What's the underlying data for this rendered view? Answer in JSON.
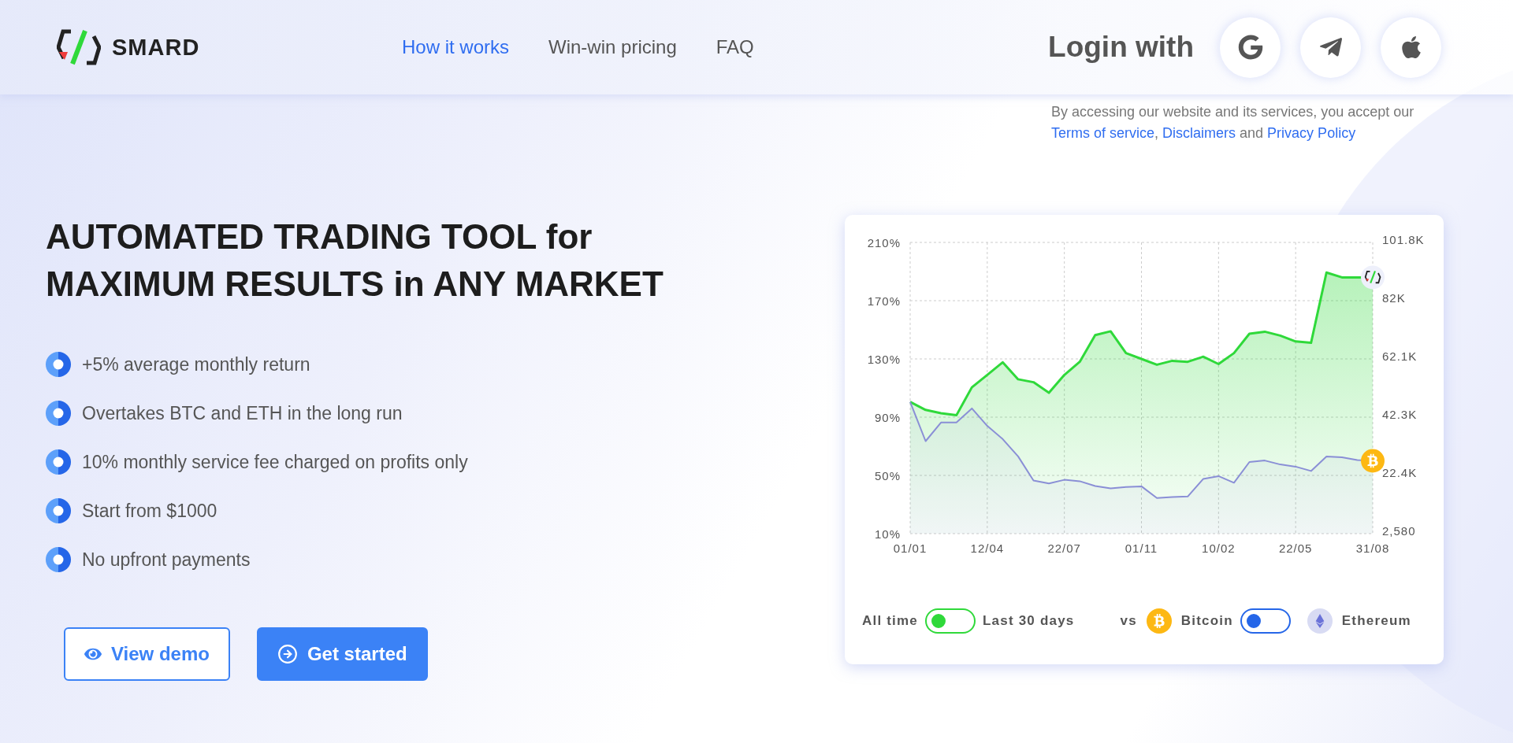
{
  "header": {
    "brand": "SMARD",
    "nav": [
      {
        "label": "How it works",
        "selected": true
      },
      {
        "label": "Win-win pricing",
        "selected": false
      },
      {
        "label": "FAQ",
        "selected": false
      }
    ],
    "login_label": "Login with",
    "login_options": [
      {
        "kind": "google"
      },
      {
        "kind": "telegram"
      },
      {
        "kind": "apple"
      }
    ]
  },
  "terms": [
    {
      "kind": "text",
      "text": "By accessing our website and its services, you accept our "
    },
    {
      "kind": "link",
      "text": "Terms of service"
    },
    {
      "kind": "text",
      "text": ", "
    },
    {
      "kind": "link",
      "text": "Disclaimers"
    },
    {
      "kind": "text",
      "text": " and "
    },
    {
      "kind": "link",
      "text": "Privacy Policy"
    }
  ],
  "hero": {
    "headline": [
      "AUTOMATED TRADING TOOL for",
      "MAXIMUM RESULTS in ANY MARKET"
    ],
    "features": [
      "+5% average monthly return",
      "Overtakes BTC and ETH in the long run",
      "10% monthly service fee charged on profits only",
      "Start from $1000",
      "No upfront payments"
    ],
    "buttons": [
      {
        "kind": "outline",
        "label": "View demo"
      },
      {
        "kind": "primary",
        "label": "Get started"
      }
    ]
  },
  "chart": {
    "chart_data": {
      "type": "area",
      "categories": [
        "01/01",
        null,
        null,
        null,
        null,
        "12/04",
        null,
        null,
        null,
        null,
        "22/07",
        null,
        null,
        null,
        null,
        "01/11",
        null,
        null,
        null,
        null,
        "10/02",
        null,
        null,
        null,
        null,
        "22/05",
        null,
        null,
        null,
        null,
        "31/08"
      ],
      "series": [
        {
          "color": "#2fd93a",
          "values": [
            100.5,
            95,
            92.7,
            91.3,
            110.5,
            119,
            127.7,
            116,
            114,
            106.7,
            119,
            128,
            146.3,
            149,
            134,
            130,
            126,
            128.7,
            128,
            131.5,
            126.5,
            134,
            147.3,
            148.7,
            146,
            142,
            141,
            189.3,
            186,
            186,
            186
          ]
        },
        {
          "color": "#8a8fd6",
          "values": [
            100.5,
            73.5,
            86.3,
            86.3,
            96,
            84,
            75,
            63,
            46.5,
            44.5,
            47,
            46,
            42.7,
            41,
            42,
            42.5,
            34.5,
            35.2,
            35.5,
            47.5,
            49.5,
            45,
            59.2,
            60.2,
            57.5,
            56,
            53,
            63,
            62.4,
            60.5,
            60
          ]
        }
      ],
      "ylim": [
        10,
        210
      ],
      "grid": true,
      "yticks": [
        {
          "value": 210,
          "label": "210%"
        },
        {
          "value": 170,
          "label": "170%"
        },
        {
          "value": 130,
          "label": "130%"
        },
        {
          "value": 90,
          "label": "90%"
        },
        {
          "value": 50,
          "label": "50%"
        },
        {
          "value": 10,
          "label": "10%"
        }
      ]
    },
    "right_axis_labels": [
      "101.8K",
      "82K",
      "62.1K",
      "42.3K",
      "22.4K",
      "2,580"
    ],
    "controls": {
      "period": {
        "left_label": "All time",
        "right_label": "Last 30 days",
        "on": false
      },
      "compare_label": "vs",
      "assets": {
        "left": {
          "kind": "bitcoin",
          "label": "Bitcoin"
        },
        "right": {
          "kind": "ethereum",
          "label": "Ethereum"
        },
        "on": false
      }
    }
  }
}
